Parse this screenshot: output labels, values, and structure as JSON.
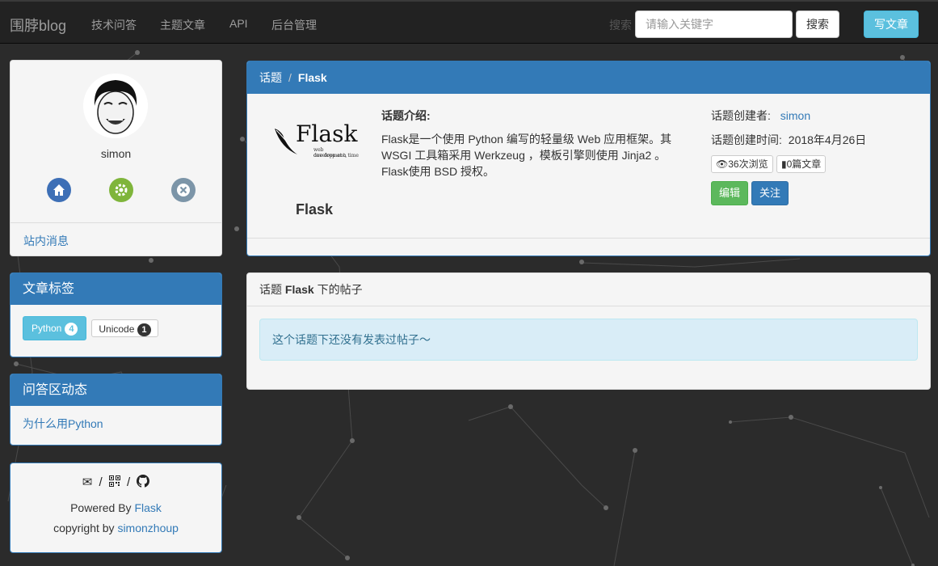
{
  "navbar": {
    "brand": "围脖blog",
    "links": [
      "技术问答",
      "主题文章",
      "API",
      "后台管理"
    ],
    "search_label": "搜索",
    "search_placeholder": "请输入关键字",
    "search_button": "搜索",
    "write_button": "写文章"
  },
  "profile": {
    "username": "simon",
    "icons": [
      "home-icon",
      "settings-icon",
      "logout-icon"
    ],
    "site_message": "站内消息"
  },
  "tags_panel": {
    "title": "文章标签",
    "tags": [
      {
        "name": "Python",
        "count": "4"
      },
      {
        "name": "Unicode",
        "count": "1"
      }
    ]
  },
  "qa_panel": {
    "title": "问答区动态",
    "items": [
      "为什么用Python"
    ]
  },
  "footer_panel": {
    "icons": [
      "mail-icon",
      "qrcode-icon",
      "github-icon"
    ],
    "separator": "/",
    "powered_prefix": "Powered By ",
    "powered_link": "Flask",
    "copyright_prefix": "copyright by ",
    "copyright_link": "simonzhoup"
  },
  "topic": {
    "breadcrumb_root": "话题",
    "breadcrumb_sep": "/",
    "breadcrumb_current": "Flask",
    "logo_text": "Flask",
    "logo_tagline_1": "web development,",
    "logo_tagline_2": "one drop at a time",
    "name": "Flask",
    "intro_title": "话题介绍:",
    "intro_text": "Flask是一个使用 Python 编写的轻量级 Web 应用框架。其 WSGI 工具箱采用 Werkzeug ，模板引擎则使用 Jinja2 。Flask使用 BSD 授权。",
    "creator_label": "话题创建者:",
    "creator": "simon",
    "created_label": "话题创建时间:",
    "created_date": "2018年4月26日",
    "views": "36次浏览",
    "articles": "0篇文章",
    "edit_button": "编辑",
    "follow_button": "关注"
  },
  "posts": {
    "heading_prefix": "话题 ",
    "heading_topic": "Flask",
    "heading_suffix": " 下的帖子",
    "empty_message": "这个话题下还没有发表过帖子～"
  },
  "colors": {
    "primary": "#337ab7",
    "info": "#5bc0de",
    "success": "#5cb85c",
    "navbar": "#222222",
    "background": "#2b2b2b"
  }
}
